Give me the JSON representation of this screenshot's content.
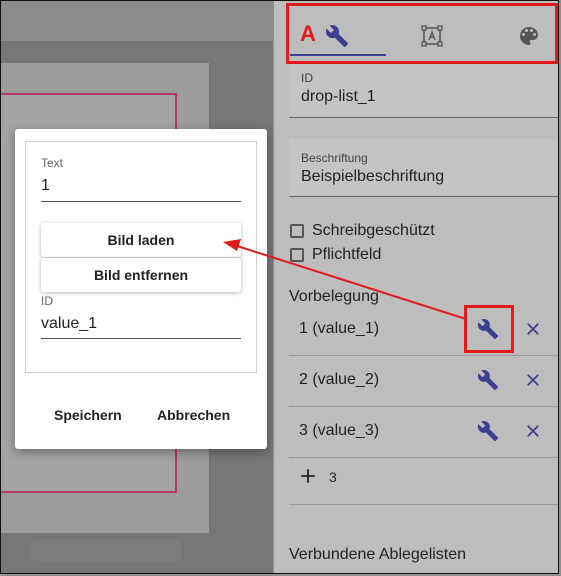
{
  "panel": {
    "tabs": [
      {
        "icon": "wrench-icon"
      },
      {
        "icon": "text-frame-icon"
      },
      {
        "icon": "palette-icon"
      }
    ],
    "annotation_letter": "A",
    "id_field": {
      "label": "ID",
      "value": "drop-list_1"
    },
    "caption_field": {
      "label": "Beschriftung",
      "value": "Beispielbeschriftung"
    },
    "readonly_label": "Schreibgeschützt",
    "required_label": "Pflichtfeld",
    "default_section": "Vorbelegung",
    "options": [
      {
        "label": "1 (value_1)"
      },
      {
        "label": "2 (value_2)"
      },
      {
        "label": "3 (value_3)"
      }
    ],
    "add_label": "3",
    "linked_lists_label": "Verbundene Ablegelisten"
  },
  "dialog": {
    "text_label": "Text",
    "text_value": "1",
    "load_image_button": "Bild laden",
    "remove_image_button": "Bild entfernen",
    "id_label": "ID",
    "id_value": "value_1",
    "save_button": "Speichern",
    "cancel_button": "Abbrechen"
  },
  "colors": {
    "accent": "#3a3f8f",
    "highlight": "#e11b1b"
  }
}
